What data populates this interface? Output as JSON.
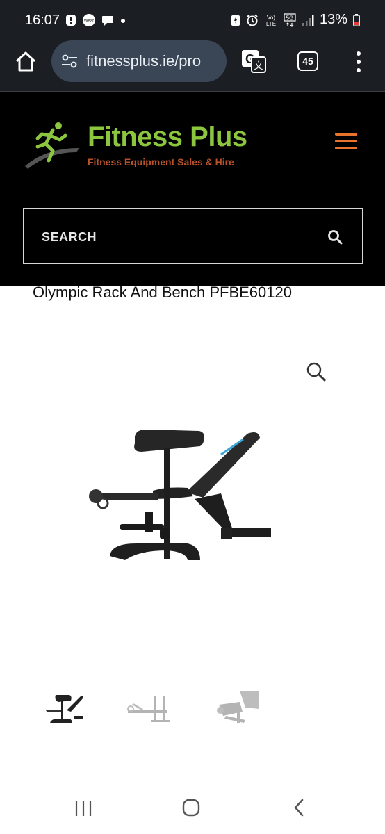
{
  "status_bar": {
    "time": "16:07",
    "left_icons": [
      "alert-icon",
      "wear-icon",
      "chat-icon",
      "dot-icon"
    ],
    "right_icons": [
      "data-saver-icon",
      "alarm-icon",
      "volte-icon",
      "5g-icon",
      "signal-icon"
    ],
    "volte_label": "Vo) LTE",
    "network_label": "5G",
    "battery_percent": "13%",
    "wear_label": "Wear"
  },
  "browser": {
    "url": "fitnessplus.ie/pro",
    "tab_count": "45",
    "icons": [
      "home-icon",
      "site-settings-icon",
      "translate-icon",
      "tabs-icon",
      "more-vert-icon"
    ]
  },
  "site": {
    "logo_title": "Fitness Plus",
    "logo_tagline": "Fitness Equipment Sales & Hire",
    "search_placeholder": "SEARCH",
    "brand_green": "#8cc63f",
    "brand_orange": "#e8732d"
  },
  "product": {
    "title": "Olympic Rack And Bench PFBE60120",
    "thumbnails": [
      "bench-front",
      "bench-side",
      "bench-angle"
    ]
  },
  "nav": {
    "icons": [
      "recents-icon",
      "home-circle-icon",
      "back-icon"
    ]
  }
}
